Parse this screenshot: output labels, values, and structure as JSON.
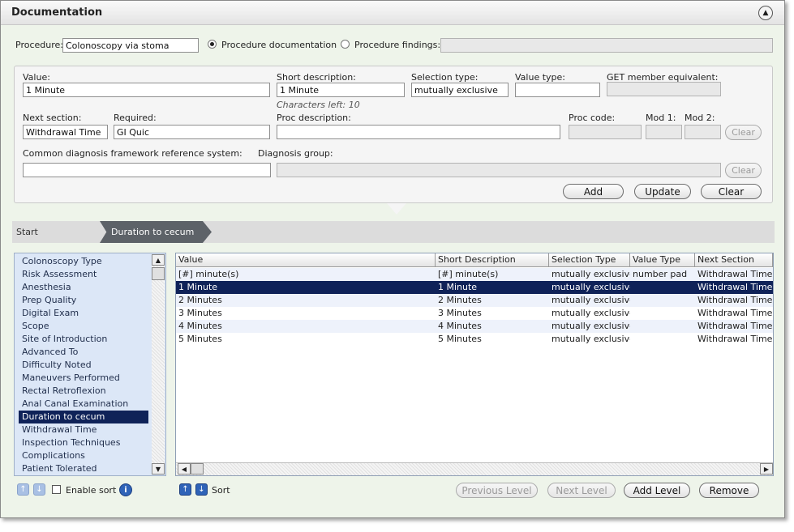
{
  "window": {
    "title": "Documentation"
  },
  "procedure": {
    "label": "Procedure:",
    "value": "Colonoscopy via stoma",
    "radio_documentation": "Procedure documentation",
    "radio_findings": "Procedure findings:",
    "findings_value": ""
  },
  "form": {
    "value_label": "Value:",
    "value": "1 Minute",
    "short_desc_label": "Short description:",
    "short_desc": "1 Minute",
    "chars_left": "Characters left: 10",
    "selection_type_label": "Selection type:",
    "selection_type": "mutually exclusive",
    "value_type_label": "Value type:",
    "value_type": "",
    "get_member_label": "GET member equivalent:",
    "get_member": "",
    "next_section_label": "Next section:",
    "next_section": "Withdrawal Time",
    "required_label": "Required:",
    "required": "GI Quic",
    "proc_desc_label": "Proc description:",
    "proc_desc": "",
    "proc_code_label": "Proc code:",
    "proc_code": "",
    "mod1_label": "Mod 1:",
    "mod1": "",
    "mod2_label": "Mod 2:",
    "mod2": "",
    "clear1": "Clear",
    "cdf_label": "Common diagnosis framework reference system:",
    "cdf": "",
    "diag_group_label": "Diagnosis group:",
    "diag_group": "",
    "clear2": "Clear",
    "add": "Add",
    "update": "Update",
    "clear": "Clear"
  },
  "breadcrumb": {
    "start": "Start",
    "current": "Duration to cecum"
  },
  "sections": [
    "Colonoscopy Type",
    "Risk Assessment",
    "Anesthesia",
    "Prep Quality",
    "Digital Exam",
    "Scope",
    "Site of Introduction",
    "Advanced To",
    "Difficulty Noted",
    "Maneuvers Performed",
    "Rectal Retroflexion",
    "Anal Canal Examination",
    "Duration to cecum",
    "Withdrawal Time",
    "Inspection Techniques",
    "Complications",
    "Patient Tolerated"
  ],
  "selected_section_index": 12,
  "grid": {
    "columns": [
      "Value",
      "Short Description",
      "Selection Type",
      "Value Type",
      "Next Section"
    ],
    "rows": [
      [
        "[#] minute(s)",
        "[#] minute(s)",
        "mutually exclusive",
        "number pad",
        "Withdrawal Time"
      ],
      [
        "1 Minute",
        "1 Minute",
        "mutually exclusive",
        "",
        "Withdrawal Time"
      ],
      [
        "2 Minutes",
        "2 Minutes",
        "mutually exclusive",
        "",
        "Withdrawal Time"
      ],
      [
        "3 Minutes",
        "3 Minutes",
        "mutually exclusive",
        "",
        "Withdrawal Time"
      ],
      [
        "4 Minutes",
        "4 Minutes",
        "mutually exclusive",
        "",
        "Withdrawal Time"
      ],
      [
        "5 Minutes",
        "5 Minutes",
        "mutually exclusive",
        "",
        "Withdrawal Time"
      ]
    ],
    "selected_row": 1
  },
  "bottom": {
    "enable_sort": "Enable sort",
    "sort": "Sort",
    "previous_level": "Previous Level",
    "next_level": "Next Level",
    "add_level": "Add Level",
    "remove": "Remove"
  }
}
